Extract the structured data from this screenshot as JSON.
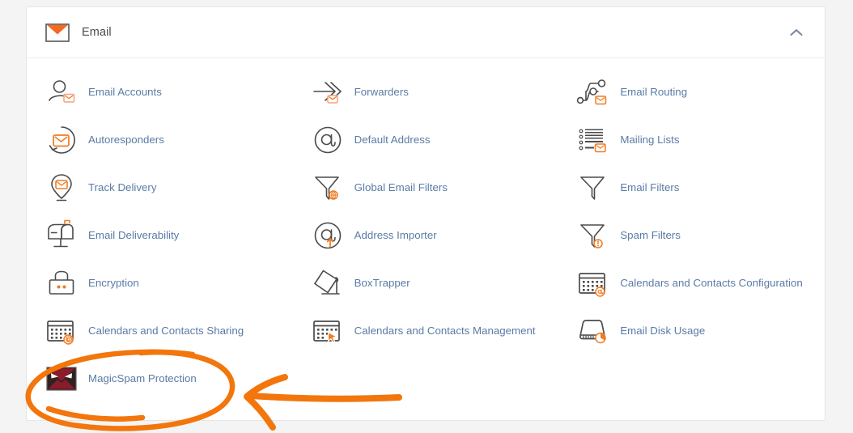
{
  "section": {
    "title": "Email",
    "icon": "envelope-icon",
    "toggle_icon": "chevron-up-icon",
    "toggle_state": "expanded"
  },
  "colors": {
    "link": "#5a7ba5",
    "accent_orange": "#f07c22",
    "annotation_orange": "#f2760c",
    "icon_outline": "#4b4b4b",
    "card_background": "#ffffff",
    "page_background": "#f4f4f4",
    "magicspam_dark": "#2e2222",
    "magicspam_red": "#8c1b2b"
  },
  "items": [
    {
      "label": "Email Accounts",
      "icon": "user-envelope-icon"
    },
    {
      "label": "Forwarders",
      "icon": "arrows-forward-envelope-icon"
    },
    {
      "label": "Email Routing",
      "icon": "routing-nodes-envelope-icon"
    },
    {
      "label": "Autoresponders",
      "icon": "refresh-envelope-icon"
    },
    {
      "label": "Default Address",
      "icon": "at-circle-icon"
    },
    {
      "label": "Mailing Lists",
      "icon": "list-envelope-icon"
    },
    {
      "label": "Track Delivery",
      "icon": "map-pin-envelope-icon"
    },
    {
      "label": "Global Email Filters",
      "icon": "funnel-globe-icon"
    },
    {
      "label": "Email Filters",
      "icon": "funnel-icon"
    },
    {
      "label": "Email Deliverability",
      "icon": "mailbox-flag-icon"
    },
    {
      "label": "Address Importer",
      "icon": "at-upload-icon"
    },
    {
      "label": "Spam Filters",
      "icon": "funnel-alert-icon"
    },
    {
      "label": "Encryption",
      "icon": "padlock-icon"
    },
    {
      "label": "BoxTrapper",
      "icon": "box-trap-icon"
    },
    {
      "label": "Calendars and Contacts Configuration",
      "icon": "calendar-at-icon"
    },
    {
      "label": "Calendars and Contacts Sharing",
      "icon": "calendar-gear-icon"
    },
    {
      "label": "Calendars and Contacts Management",
      "icon": "calendar-cursor-icon"
    },
    {
      "label": "Email Disk Usage",
      "icon": "disk-pie-icon"
    },
    {
      "label": "MagicSpam Protection",
      "icon": "magicspam-angry-envelope-icon"
    }
  ],
  "annotation": {
    "ellipse_target": "MagicSpam Protection",
    "arrow_direction": "left",
    "shape": "hand-drawn-ellipse-and-arrow"
  }
}
